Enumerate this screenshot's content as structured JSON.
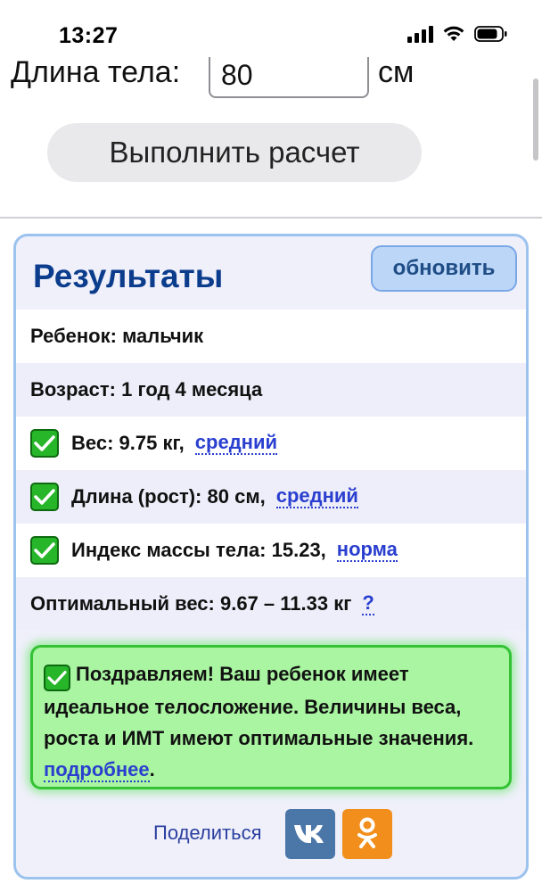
{
  "status_bar": {
    "time": "13:27"
  },
  "form": {
    "length_label": "Длина тела:",
    "length_value": "80",
    "length_unit": "см",
    "calc_button_label": "Выполнить расчет"
  },
  "results": {
    "title": "Результаты",
    "refresh_label": "обновить",
    "rows": [
      {
        "text": "Ребенок: мальчик"
      },
      {
        "text": "Возраст: 1 год 4 месяца"
      },
      {
        "text": "Вес: 9.75 кг,",
        "link": "средний",
        "checked": true
      },
      {
        "text": "Длина (рост): 80 см,",
        "link": "средний",
        "checked": true
      },
      {
        "text": "Индекс массы тела: 15.23,",
        "link": "норма",
        "checked": true
      },
      {
        "text": "Оптимальный вес: 9.67 – 11.33 кг",
        "link": "?"
      }
    ],
    "congrats": {
      "text": "Поздравляем! Ваш ребенок имеет идеальное телосложение. Величины веса, роста и ИМТ имеют оптимальные значения.",
      "link": "подробнее",
      "tail": "."
    },
    "share": {
      "label": "Поделиться",
      "vk_icon": "vk-icon",
      "ok_icon": "odnoklassniki-icon"
    }
  },
  "colors": {
    "title": "#0b3d8c",
    "link": "#2a3fcf",
    "check": "#27b52a",
    "congrats_bg": "#a9f5a1",
    "vk": "#4a76a8",
    "ok": "#f28e1c"
  }
}
